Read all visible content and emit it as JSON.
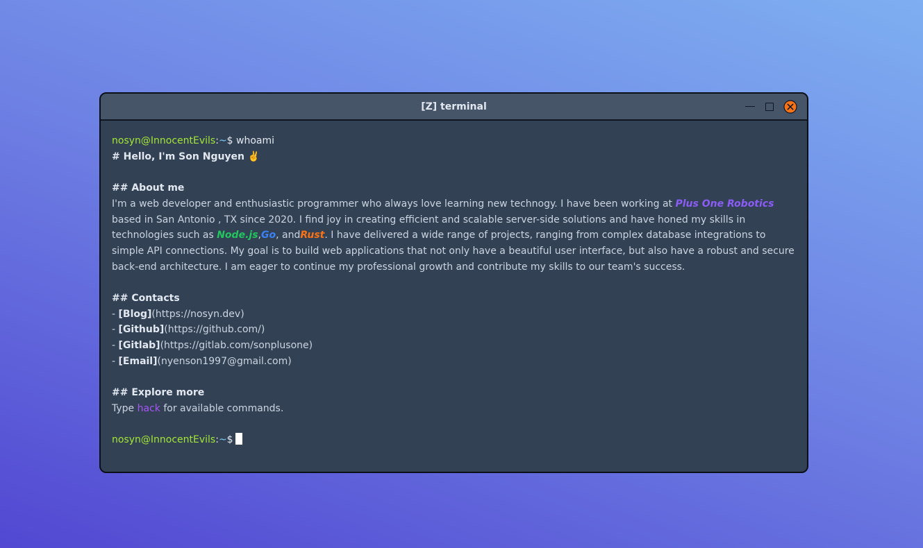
{
  "window": {
    "title": "[Z] terminal"
  },
  "controls": {
    "minimize": "minimize-icon",
    "maximize": "maximize-icon",
    "close": "close-icon",
    "close_color": "#f97316"
  },
  "prompt": {
    "user": "nosyn@InnocentEvils",
    "sep": ":",
    "path": "~",
    "dollar": "$"
  },
  "session": {
    "command": "whoami",
    "heading": "# Hello, I'm Son Nguyen ✌️",
    "about_heading": "## About me",
    "about": {
      "t1": "I'm a web developer and enthusiastic programmer who always love learning new technogy. I have been working at ",
      "company": "Plus One Robotics",
      "t2": " based in San Antonio , TX since 2020. I find joy in creating efficient and scalable server-side solutions and have honed my skills in technologies such as ",
      "tech1": "Node.js",
      "sep1": ",",
      "tech2": "Go",
      "sep2": ", and",
      "tech3": "Rust",
      "t3": ". I have delivered a wide range of projects, ranging from complex database integrations to simple API connections. My goal is to build web applications that not only have a beautiful user interface, but also have a robust and secure back-end architecture. I am eager to continue my professional growth and contribute my skills to our team's success."
    },
    "contacts_heading": "## Contacts",
    "contacts": [
      {
        "dash": "- ",
        "label": "[Blog]",
        "url": "(https://nosyn.dev)"
      },
      {
        "dash": "- ",
        "label": "[Github]",
        "url": "(https://github.com/)"
      },
      {
        "dash": "- ",
        "label": "[Gitlab]",
        "url": "(https://gitlab.com/sonplusone)"
      },
      {
        "dash": "- ",
        "label": "[Email]",
        "url": "(nyenson1997@gmail.com)"
      }
    ],
    "explore_heading": "## Explore more",
    "explore": {
      "pre": "Type ",
      "cmd": "hack",
      "post": " for available commands."
    }
  },
  "colors": {
    "prompt_user": "#a3e635",
    "prompt_path": "#7dd3fc",
    "company": "#8b5cf6",
    "nodejs": "#22c55e",
    "go": "#3b82f6",
    "rust": "#f97316",
    "hack": "#a855f7"
  }
}
